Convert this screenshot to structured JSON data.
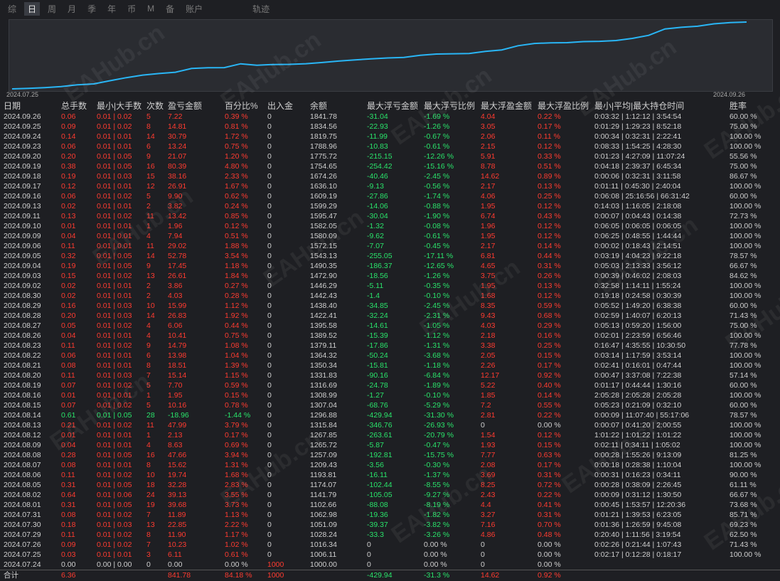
{
  "tabs": [
    {
      "label": "综",
      "active": false
    },
    {
      "label": "日",
      "active": true
    },
    {
      "label": "周",
      "active": false
    },
    {
      "label": "月",
      "active": false
    },
    {
      "label": "季",
      "active": false
    },
    {
      "label": "年",
      "active": false
    },
    {
      "label": "币",
      "active": false
    },
    {
      "label": "M",
      "active": false
    },
    {
      "label": "备",
      "active": false
    },
    {
      "label": "账户",
      "active": false
    },
    {
      "label": "轨迹",
      "active": false
    }
  ],
  "chart_data": {
    "type": "line",
    "x_start": "2024.07.25",
    "x_end": "2024.09.26",
    "line_color": "#29b6f6",
    "series": [
      {
        "values": [
          1000.0,
          1006.11,
          1016.34,
          1028.24,
          1051.09,
          1062.98,
          1102.66,
          1141.79,
          1174.07,
          1193.81,
          1209.43,
          1257.09,
          1265.72,
          1267.85,
          1315.84,
          1296.88,
          1307.04,
          1308.99,
          1316.69,
          1331.83,
          1350.34,
          1364.32,
          1379.11,
          1389.52,
          1395.58,
          1422.41,
          1438.4,
          1442.43,
          1446.29,
          1472.9,
          1490.35,
          1543.13,
          1572.15,
          1580.09,
          1582.05,
          1595.47,
          1599.29,
          1609.19,
          1636.1,
          1674.26,
          1754.65,
          1775.72,
          1788.96,
          1819.75,
          1834.56,
          1841.78
        ]
      }
    ]
  },
  "table": {
    "headers": [
      "日期",
      "总手数",
      "最小|大手数",
      "次数",
      "盈亏金额",
      "百分比%",
      "出入金",
      "余额",
      "最大浮亏金额",
      "最大浮亏比例",
      "最大浮盈金额",
      "最大浮盈比例",
      "最小|平均|最大持仓时间",
      "胜率"
    ],
    "rows": [
      [
        "2024.09.26",
        "0.06",
        "0.01 | 0.02",
        "5",
        "7.22",
        "0.39 %",
        "0",
        "1841.78",
        "-31.04",
        "-1.69 %",
        "4.04",
        "0.22 %",
        "0:03:32 | 1:12:12 | 3:54:54",
        "60.00 %"
      ],
      [
        "2024.09.25",
        "0.09",
        "0.01 | 0.02",
        "8",
        "14.81",
        "0.81 %",
        "0",
        "1834.56",
        "-22.93",
        "-1.26 %",
        "3.05",
        "0.17 %",
        "0:01:29 | 1:29:23 | 8:52:18",
        "75.00 %"
      ],
      [
        "2024.09.24",
        "0.14",
        "0.01 | 0.01",
        "14",
        "30.79",
        "1.72 %",
        "0",
        "1819.75",
        "-11.99",
        "-0.67 %",
        "2.06",
        "0.11 %",
        "0:00:34 | 0:32:31 | 2:22:41",
        "100.00 %"
      ],
      [
        "2024.09.23",
        "0.06",
        "0.01 | 0.01",
        "6",
        "13.24",
        "0.75 %",
        "0",
        "1788.96",
        "-10.83",
        "-0.61 %",
        "2.15",
        "0.12 %",
        "0:08:33 | 1:54:25 | 4:28:30",
        "100.00 %"
      ],
      [
        "2024.09.20",
        "0.20",
        "0.01 | 0.05",
        "9",
        "21.07",
        "1.20 %",
        "0",
        "1775.72",
        "-215.15",
        "-12.26 %",
        "5.91",
        "0.33 %",
        "0:01:23 | 4:27:09 | 11:07:24",
        "55.56 %"
      ],
      [
        "2024.09.19",
        "0.38",
        "0.01 | 0.05",
        "16",
        "80.39",
        "4.80 %",
        "0",
        "1754.65",
        "-254.42",
        "-15.16 %",
        "8.78",
        "0.51 %",
        "0:04:18 | 2:39:37 | 6:45:34",
        "75.00 %"
      ],
      [
        "2024.09.18",
        "0.19",
        "0.01 | 0.03",
        "15",
        "38.16",
        "2.33 %",
        "0",
        "1674.26",
        "-40.46",
        "-2.45 %",
        "14.62",
        "0.89 %",
        "0:00:06 | 0:32:31 | 3:11:58",
        "86.67 %"
      ],
      [
        "2024.09.17",
        "0.12",
        "0.01 | 0.01",
        "12",
        "26.91",
        "1.67 %",
        "0",
        "1636.10",
        "-9.13",
        "-0.56 %",
        "2.17",
        "0.13 %",
        "0:01:11 | 0:45:30 | 2:40:04",
        "100.00 %"
      ],
      [
        "2024.09.16",
        "0.06",
        "0.01 | 0.02",
        "5",
        "9.90",
        "0.62 %",
        "0",
        "1609.19",
        "-27.86",
        "-1.74 %",
        "4.06",
        "0.25 %",
        "0:06:08 | 25:16:56 | 66:31:42",
        "60.00 %"
      ],
      [
        "2024.09.13",
        "0.02",
        "0.01 | 0.01",
        "2",
        "3.82",
        "0.24 %",
        "0",
        "1599.29",
        "-14.06",
        "-0.88 %",
        "1.95",
        "0.12 %",
        "0:14:03 | 1:16:05 | 2:18:08",
        "100.00 %"
      ],
      [
        "2024.09.11",
        "0.13",
        "0.01 | 0.02",
        "11",
        "13.42",
        "0.85 %",
        "0",
        "1595.47",
        "-30.04",
        "-1.90 %",
        "6.74",
        "0.43 %",
        "0:00:07 | 0:04:43 | 0:14:38",
        "72.73 %"
      ],
      [
        "2024.09.10",
        "0.01",
        "0.01 | 0.01",
        "1",
        "1.96",
        "0.12 %",
        "0",
        "1582.05",
        "-1.32",
        "-0.08 %",
        "1.96",
        "0.12 %",
        "0:06:05 | 0:06:05 | 0:06:05",
        "100.00 %"
      ],
      [
        "2024.09.09",
        "0.04",
        "0.01 | 0.01",
        "4",
        "7.94",
        "0.51 %",
        "0",
        "1580.09",
        "-9.62",
        "-0.61 %",
        "1.95",
        "0.12 %",
        "0:06:25 | 0:48:55 | 1:44:44",
        "100.00 %"
      ],
      [
        "2024.09.06",
        "0.11",
        "0.01 | 0.01",
        "11",
        "29.02",
        "1.88 %",
        "0",
        "1572.15",
        "-7.07",
        "-0.45 %",
        "2.17",
        "0.14 %",
        "0:00:02 | 0:18:43 | 2:14:51",
        "100.00 %"
      ],
      [
        "2024.09.05",
        "0.32",
        "0.01 | 0.05",
        "14",
        "52.78",
        "3.54 %",
        "0",
        "1543.13",
        "-255.05",
        "-17.11 %",
        "6.81",
        "0.44 %",
        "0:03:19 | 4:04:23 | 9:22:18",
        "78.57 %"
      ],
      [
        "2024.09.04",
        "0.19",
        "0.01 | 0.05",
        "9",
        "17.45",
        "1.18 %",
        "0",
        "1490.35",
        "-186.37",
        "-12.65 %",
        "4.65",
        "0.31 %",
        "0:05:03 | 2:13:33 | 3:56:12",
        "66.67 %"
      ],
      [
        "2024.09.03",
        "0.15",
        "0.01 | 0.02",
        "13",
        "26.61",
        "1.84 %",
        "0",
        "1472.90",
        "-18.56",
        "-1.26 %",
        "3.75",
        "0.26 %",
        "0:00:39 | 0:46:02 | 2:08:03",
        "84.62 %"
      ],
      [
        "2024.09.02",
        "0.02",
        "0.01 | 0.01",
        "2",
        "3.86",
        "0.27 %",
        "0",
        "1446.29",
        "-5.11",
        "-0.35 %",
        "1.95",
        "0.13 %",
        "0:32:58 | 1:14:11 | 1:55:24",
        "100.00 %"
      ],
      [
        "2024.08.30",
        "0.02",
        "0.01 | 0.01",
        "2",
        "4.03",
        "0.28 %",
        "0",
        "1442.43",
        "-1.4",
        "-0.10 %",
        "1.68",
        "0.12 %",
        "0:19:18 | 0:24:58 | 0:30:39",
        "100.00 %"
      ],
      [
        "2024.08.29",
        "0.16",
        "0.01 | 0.03",
        "10",
        "15.99",
        "1.12 %",
        "0",
        "1438.40",
        "-34.85",
        "-2.45 %",
        "8.35",
        "0.59 %",
        "0:05:52 | 1:49:20 | 6:38:38",
        "60.00 %"
      ],
      [
        "2024.08.28",
        "0.20",
        "0.01 | 0.03",
        "14",
        "26.83",
        "1.92 %",
        "0",
        "1422.41",
        "-32.24",
        "-2.31 %",
        "9.43",
        "0.68 %",
        "0:02:59 | 1:40:07 | 6:20:13",
        "71.43 %"
      ],
      [
        "2024.08.27",
        "0.05",
        "0.01 | 0.02",
        "4",
        "6.06",
        "0.44 %",
        "0",
        "1395.58",
        "-14.61",
        "-1.05 %",
        "4.03",
        "0.29 %",
        "0:05:13 | 0:59:20 | 1:56:00",
        "75.00 %"
      ],
      [
        "2024.08.26",
        "0.04",
        "0.01 | 0.01",
        "4",
        "10.41",
        "0.75 %",
        "0",
        "1389.52",
        "-15.39",
        "-1.12 %",
        "2.18",
        "0.16 %",
        "0:02:01 | 2:23:59 | 6:56:46",
        "100.00 %"
      ],
      [
        "2024.08.23",
        "0.11",
        "0.01 | 0.02",
        "9",
        "14.79",
        "1.08 %",
        "0",
        "1379.11",
        "-17.86",
        "-1.31 %",
        "3.38",
        "0.25 %",
        "0:16:47 | 4:35:55 | 10:30:50",
        "77.78 %"
      ],
      [
        "2024.08.22",
        "0.06",
        "0.01 | 0.01",
        "6",
        "13.98",
        "1.04 %",
        "0",
        "1364.32",
        "-50.24",
        "-3.68 %",
        "2.05",
        "0.15 %",
        "0:03:14 | 1:17:59 | 3:53:14",
        "100.00 %"
      ],
      [
        "2024.08.21",
        "0.08",
        "0.01 | 0.01",
        "8",
        "18.51",
        "1.39 %",
        "0",
        "1350.34",
        "-15.81",
        "-1.18 %",
        "2.26",
        "0.17 %",
        "0:02:41 | 0:16:01 | 0:47:44",
        "100.00 %"
      ],
      [
        "2024.08.20",
        "0.11",
        "0.01 | 0.03",
        "7",
        "15.14",
        "1.15 %",
        "0",
        "1331.83",
        "-90.16",
        "-6.84 %",
        "12.17",
        "0.92 %",
        "0:00:47 | 3:37:08 | 7:22:38",
        "57.14 %"
      ],
      [
        "2024.08.19",
        "0.07",
        "0.01 | 0.02",
        "5",
        "7.70",
        "0.59 %",
        "0",
        "1316.69",
        "-24.78",
        "-1.89 %",
        "5.22",
        "0.40 %",
        "0:01:17 | 0:44:44 | 1:30:16",
        "60.00 %"
      ],
      [
        "2024.08.16",
        "0.01",
        "0.01 | 0.01",
        "1",
        "1.95",
        "0.15 %",
        "0",
        "1308.99",
        "-1.27",
        "-0.10 %",
        "1.85",
        "0.14 %",
        "2:05:28 | 2:05:28 | 2:05:28",
        "100.00 %"
      ],
      [
        "2024.08.15",
        "0.07",
        "0.01 | 0.02",
        "5",
        "10.16",
        "0.78 %",
        "0",
        "1307.04",
        "-68.76",
        "-5.29 %",
        "7.2",
        "0.55 %",
        "0:05:23 | 0:21:09 | 0:32:10",
        "60.00 %"
      ],
      [
        "2024.08.14",
        "0.61",
        "0.01 | 0.05",
        "28",
        "-18.96",
        "-1.44 %",
        "0",
        "1296.88",
        "-429.94",
        "-31.30 %",
        "2.81",
        "0.22 %",
        "0:00:09 | 11:07:40 | 55:17:06",
        "78.57 %"
      ],
      [
        "2024.08.13",
        "0.21",
        "0.01 | 0.02",
        "11",
        "47.99",
        "3.79 %",
        "0",
        "1315.84",
        "-346.76",
        "-26.93 %",
        "0",
        "0.00 %",
        "0:00:07 | 0:41:20 | 2:00:55",
        "100.00 %"
      ],
      [
        "2024.08.12",
        "0.01",
        "0.01 | 0.01",
        "1",
        "2.13",
        "0.17 %",
        "0",
        "1267.85",
        "-263.61",
        "-20.79 %",
        "1.54",
        "0.12 %",
        "1:01:22 | 1:01:22 | 1:01:22",
        "100.00 %"
      ],
      [
        "2024.08.09",
        "0.04",
        "0.01 | 0.01",
        "4",
        "8.63",
        "0.69 %",
        "0",
        "1265.72",
        "-5.87",
        "-0.47 %",
        "1.93",
        "0.15 %",
        "0:02:11 | 0:34:11 | 1:05:02",
        "100.00 %"
      ],
      [
        "2024.08.08",
        "0.28",
        "0.01 | 0.05",
        "16",
        "47.66",
        "3.94 %",
        "0",
        "1257.09",
        "-192.81",
        "-15.75 %",
        "7.77",
        "0.63 %",
        "0:00:28 | 1:55:26 | 9:13:09",
        "81.25 %"
      ],
      [
        "2024.08.07",
        "0.08",
        "0.01 | 0.01",
        "8",
        "15.62",
        "1.31 %",
        "0",
        "1209.43",
        "-3.56",
        "-0.30 %",
        "2.08",
        "0.17 %",
        "0:00:18 | 0:28:38 | 1:10:04",
        "100.00 %"
      ],
      [
        "2024.08.06",
        "0.11",
        "0.01 | 0.02",
        "10",
        "19.74",
        "1.68 %",
        "0",
        "1193.81",
        "-16.11",
        "-1.37 %",
        "3.69",
        "0.31 %",
        "0:00:31 | 0:16:23 | 0:34:11",
        "90.00 %"
      ],
      [
        "2024.08.05",
        "0.31",
        "0.01 | 0.05",
        "18",
        "32.28",
        "2.83 %",
        "0",
        "1174.07",
        "-102.44",
        "-8.55 %",
        "8.25",
        "0.72 %",
        "0:00:28 | 0:38:09 | 2:26:45",
        "61.11 %"
      ],
      [
        "2024.08.02",
        "0.64",
        "0.01 | 0.06",
        "24",
        "39.13",
        "3.55 %",
        "0",
        "1141.79",
        "-105.05",
        "-9.27 %",
        "2.43",
        "0.22 %",
        "0:00:09 | 0:31:12 | 1:30:50",
        "66.67 %"
      ],
      [
        "2024.08.01",
        "0.31",
        "0.01 | 0.05",
        "19",
        "39.68",
        "3.73 %",
        "0",
        "1102.66",
        "-88.08",
        "-8.19 %",
        "4.4",
        "0.41 %",
        "0:00:45 | 1:53:57 | 12:20:36",
        "73.68 %"
      ],
      [
        "2024.07.31",
        "0.08",
        "0.01 | 0.02",
        "7",
        "11.89",
        "1.13 %",
        "0",
        "1062.98",
        "-19.36",
        "-1.82 %",
        "3.27",
        "0.31 %",
        "0:01:21 | 1:39:53 | 6:23:05",
        "85.71 %"
      ],
      [
        "2024.07.30",
        "0.18",
        "0.01 | 0.03",
        "13",
        "22.85",
        "2.22 %",
        "0",
        "1051.09",
        "-39.37",
        "-3.82 %",
        "7.16",
        "0.70 %",
        "0:01:36 | 1:26:59 | 9:45:08",
        "69.23 %"
      ],
      [
        "2024.07.29",
        "0.11",
        "0.01 | 0.02",
        "8",
        "11.90",
        "1.17 %",
        "0",
        "1028.24",
        "-33.3",
        "-3.26 %",
        "4.86",
        "0.48 %",
        "0:20:40 | 1:11:56 | 3:19:54",
        "62.50 %"
      ],
      [
        "2024.07.26",
        "0.09",
        "0.01 | 0.02",
        "7",
        "10.23",
        "1.02 %",
        "0",
        "1016.34",
        "0",
        "0.00 %",
        "0",
        "0.00 %",
        "0:02:26 | 0:21:44 | 1:07:43",
        "71.43 %"
      ],
      [
        "2024.07.25",
        "0.03",
        "0.01 | 0.01",
        "3",
        "6.11",
        "0.61 %",
        "0",
        "1006.11",
        "0",
        "0.00 %",
        "0",
        "0.00 %",
        "0:02:17 | 0:12:28 | 0:18:17",
        "100.00 %"
      ],
      [
        "2024.07.24",
        "0.00",
        "0.00 | 0.00",
        "0",
        "0.00",
        "0.00 %",
        "1000",
        "1000.00",
        "0",
        "0.00 %",
        "0",
        "0.00 %",
        "",
        ""
      ]
    ],
    "summary": [
      "合计",
      "6.36",
      "",
      "",
      "841.78",
      "84.18 %",
      "1000",
      "",
      "-429.94",
      "-31.3 %",
      "14.62",
      "0.92 %",
      "",
      ""
    ]
  },
  "watermark": "EAHub.cn",
  "colors": {
    "up": "#ff3b30",
    "down": "#29e36a",
    "neutral": "#cfcfcf",
    "line": "#29b6f6",
    "bg": "#1e1f23"
  }
}
